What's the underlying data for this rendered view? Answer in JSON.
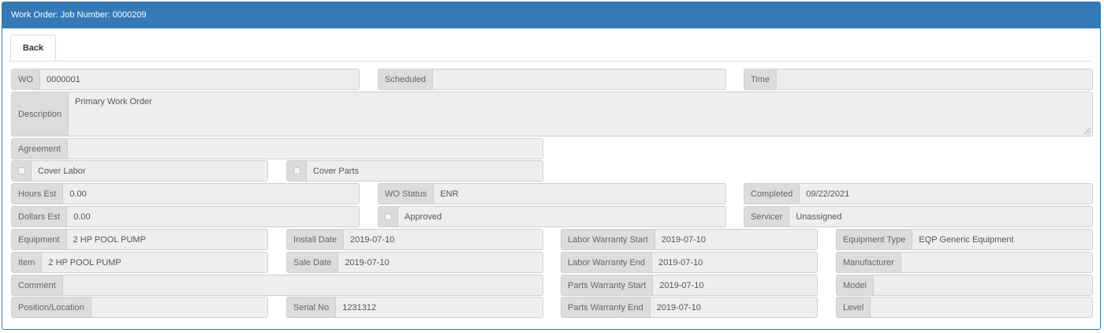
{
  "header": {
    "title": "Work Order: Job Number: 0000209"
  },
  "tabs": {
    "back_label": "Back"
  },
  "form": {
    "wo": {
      "label": "WO",
      "value": "0000001"
    },
    "scheduled": {
      "label": "Scheduled",
      "value": ""
    },
    "time": {
      "label": "Time",
      "value": ""
    },
    "description": {
      "label": "Description",
      "value": "Primary Work Order"
    },
    "agreement": {
      "label": "Agreement",
      "value": ""
    },
    "cover_labor": {
      "label": "Cover Labor",
      "checked": false
    },
    "cover_parts": {
      "label": "Cover Parts",
      "checked": false
    },
    "hours_est": {
      "label": "Hours Est",
      "value": "0.00"
    },
    "wo_status": {
      "label": "WO Status",
      "value": "ENR"
    },
    "completed": {
      "label": "Completed",
      "value": "09/22/2021"
    },
    "dollars_est": {
      "label": "Dollars Est",
      "value": "0.00"
    },
    "approved": {
      "label": "Approved",
      "checked": false
    },
    "servicer": {
      "label": "Servicer",
      "value": "Unassigned"
    },
    "equipment": {
      "label": "Equipment",
      "value": "2 HP POOL PUMP"
    },
    "install_date": {
      "label": "Install Date",
      "value": "2019-07-10"
    },
    "labor_warranty_start": {
      "label": "Labor Warranty Start",
      "value": "2019-07-10"
    },
    "equipment_type": {
      "label": "Equipment Type",
      "value": "EQP Generic Equipment"
    },
    "item": {
      "label": "Item",
      "value": "2 HP POOL PUMP"
    },
    "sale_date": {
      "label": "Sale Date",
      "value": "2019-07-10"
    },
    "labor_warranty_end": {
      "label": "Labor Warranty End",
      "value": "2019-07-10"
    },
    "manufacturer": {
      "label": "Manufacturer",
      "value": ""
    },
    "comment": {
      "label": "Comment",
      "value": ""
    },
    "parts_warranty_start": {
      "label": "Parts Warranty Start",
      "value": "2019-07-10"
    },
    "model": {
      "label": "Model",
      "value": ""
    },
    "position_location": {
      "label": "Position/Location",
      "value": ""
    },
    "serial_no": {
      "label": "Serial No",
      "value": "1231312"
    },
    "parts_warranty_end": {
      "label": "Parts Warranty End",
      "value": "2019-07-10"
    },
    "level": {
      "label": "Level",
      "value": ""
    }
  },
  "colors": {
    "header_bg": "#337ab7",
    "label_bg": "#dcdcdc",
    "field_bg": "#eeeeee"
  }
}
